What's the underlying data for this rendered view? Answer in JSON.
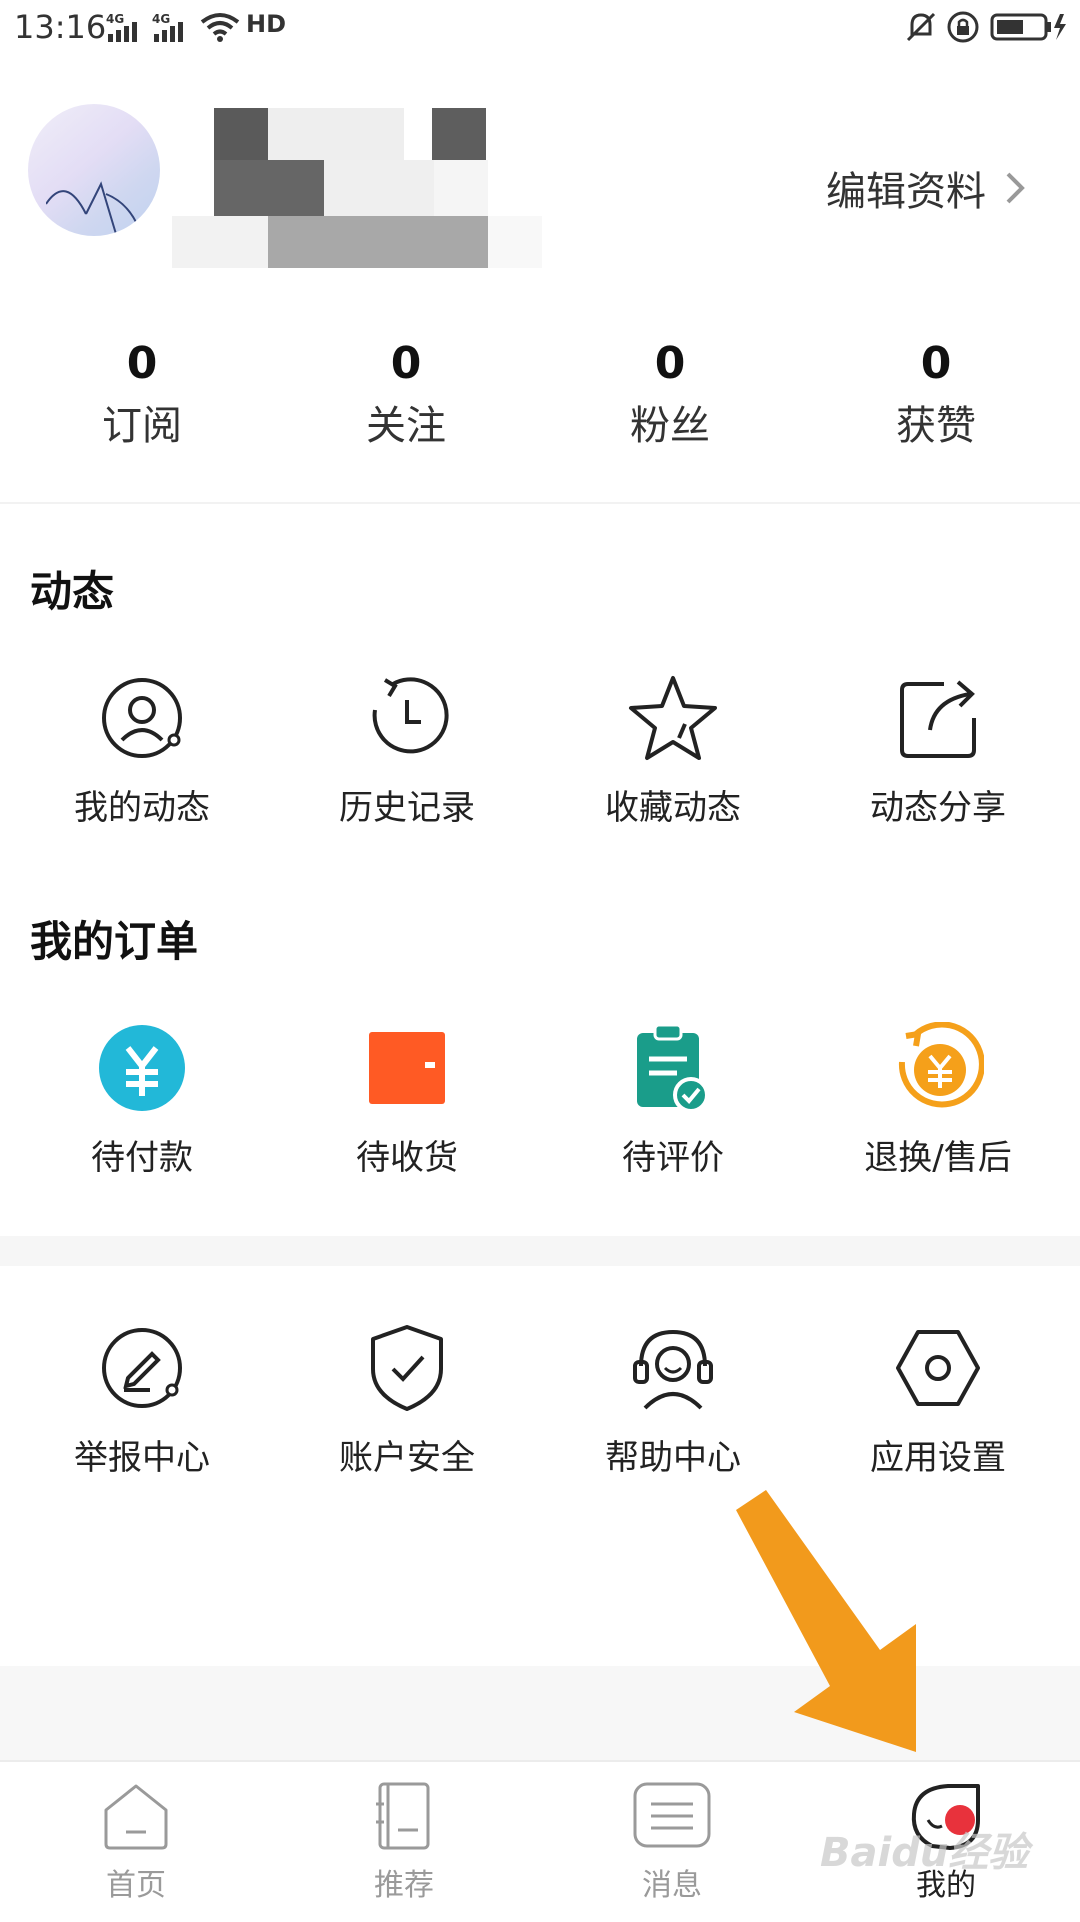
{
  "status_bar": {
    "time": "13:16",
    "signal1": "4G",
    "signal2": "4G",
    "hd": "HD"
  },
  "profile": {
    "edit_label": "编辑资料"
  },
  "stats": [
    {
      "value": "0",
      "label": "订阅"
    },
    {
      "value": "0",
      "label": "关注"
    },
    {
      "value": "0",
      "label": "粉丝"
    },
    {
      "value": "0",
      "label": "获赞"
    }
  ],
  "activity": {
    "title": "动态",
    "items": [
      {
        "label": "我的动态",
        "icon": "my-activity-icon"
      },
      {
        "label": "历史记录",
        "icon": "history-icon"
      },
      {
        "label": "收藏动态",
        "icon": "star-icon"
      },
      {
        "label": "动态分享",
        "icon": "share-icon"
      }
    ]
  },
  "orders": {
    "title": "我的订单",
    "items": [
      {
        "label": "待付款",
        "icon": "yuan-icon",
        "color": "#22b8d8"
      },
      {
        "label": "待收货",
        "icon": "wallet-icon",
        "color": "#ff5a24"
      },
      {
        "label": "待评价",
        "icon": "clipboard-check-icon",
        "color": "#1a9d8a"
      },
      {
        "label": "退换/售后",
        "icon": "refund-icon",
        "color": "#f5a01a"
      }
    ]
  },
  "services": {
    "items": [
      {
        "label": "举报中心",
        "icon": "report-icon"
      },
      {
        "label": "账户安全",
        "icon": "shield-icon"
      },
      {
        "label": "帮助中心",
        "icon": "headset-icon"
      },
      {
        "label": "应用设置",
        "icon": "settings-icon"
      }
    ]
  },
  "bottom_nav": {
    "active": "我的",
    "items": [
      {
        "label": "首页",
        "icon": "home-icon"
      },
      {
        "label": "推荐",
        "icon": "book-icon"
      },
      {
        "label": "消息",
        "icon": "message-icon"
      },
      {
        "label": "我的",
        "icon": "profile-icon"
      }
    ]
  },
  "watermark": "Baidu经验",
  "colors": {
    "accent_arrow": "#f29a1c",
    "badge_red": "#e8323c"
  }
}
